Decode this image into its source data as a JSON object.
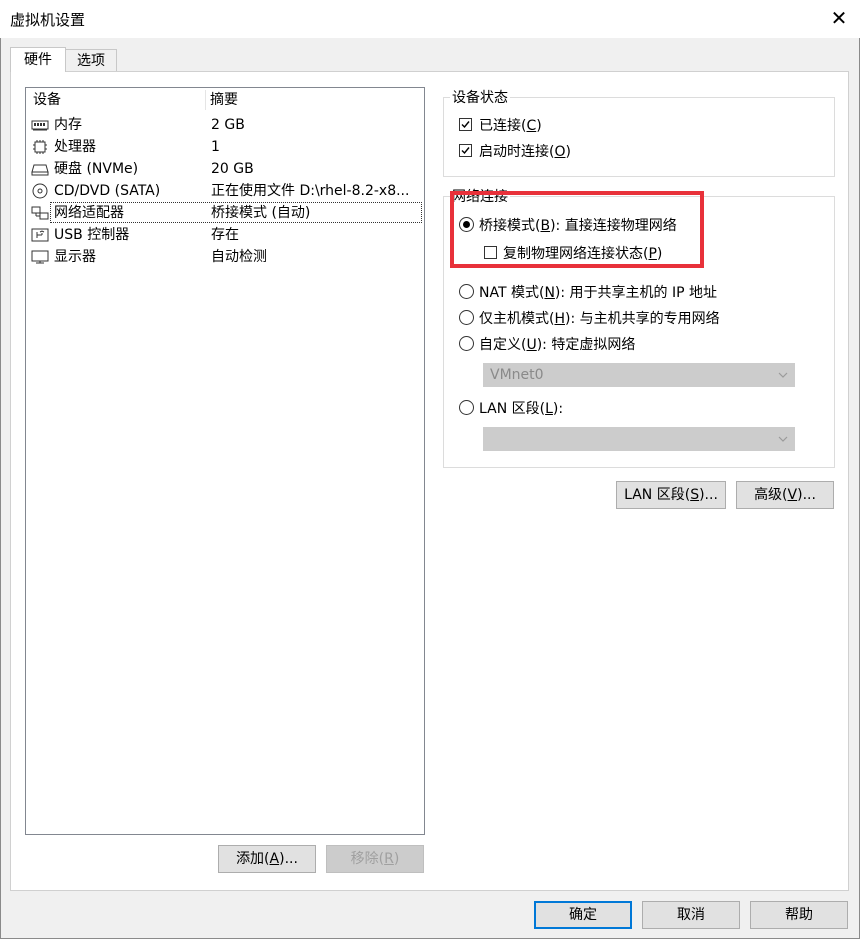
{
  "window": {
    "title": "虚拟机设置",
    "close_glyph": "✕"
  },
  "tabs": [
    {
      "label": "硬件",
      "active": true
    },
    {
      "label": "选项",
      "active": false
    }
  ],
  "device_list": {
    "headers": {
      "device": "设备",
      "summary": "摘要"
    },
    "rows": [
      {
        "name": "内存",
        "summary": "2 GB",
        "icon": "memory-icon"
      },
      {
        "name": "处理器",
        "summary": "1",
        "icon": "cpu-icon"
      },
      {
        "name": "硬盘 (NVMe)",
        "summary": "20 GB",
        "icon": "hard-disk-icon"
      },
      {
        "name": "CD/DVD (SATA)",
        "summary": "正在使用文件 D:\\rhel-8.2-x8...",
        "icon": "cd-dvd-icon"
      },
      {
        "name": "网络适配器",
        "summary": "桥接模式 (自动)",
        "icon": "network-adapter-icon",
        "selected": true
      },
      {
        "name": "USB 控制器",
        "summary": "存在",
        "icon": "usb-icon"
      },
      {
        "name": "显示器",
        "summary": "自动检测",
        "icon": "monitor-icon"
      }
    ]
  },
  "list_buttons": {
    "add": {
      "text": "添加(",
      "key": "A",
      "tail": ")..."
    },
    "remove": {
      "text": "移除(",
      "key": "R",
      "tail": ")"
    }
  },
  "device_status": {
    "title": "设备状态",
    "connected": {
      "text": "已连接(",
      "key": "C",
      "tail": ")",
      "checked": true
    },
    "connect_on_start": {
      "text": "启动时连接(",
      "key": "O",
      "tail": ")",
      "checked": true
    }
  },
  "network": {
    "title": "网络连接",
    "bridged": {
      "text": "桥接模式(",
      "key": "B",
      "tail": "): 直接连接物理网络",
      "selected": true
    },
    "replicate": {
      "text": "复制物理网络连接状态(",
      "key": "P",
      "tail": ")",
      "checked": false
    },
    "nat": {
      "text": "NAT 模式(",
      "key": "N",
      "tail": "): 用于共享主机的 IP 地址",
      "selected": false
    },
    "hostonly": {
      "text": "仅主机模式(",
      "key": "H",
      "tail": "): 与主机共享的专用网络",
      "selected": false
    },
    "custom": {
      "text": "自定义(",
      "key": "U",
      "tail": "): 特定虚拟网络",
      "selected": false
    },
    "custom_select_value": "VMnet0",
    "lan": {
      "text": "LAN 区段(",
      "key": "L",
      "tail": "):",
      "selected": false
    },
    "lan_select_value": ""
  },
  "network_buttons": {
    "lan_segments": {
      "text": "LAN 区段(",
      "key": "S",
      "tail": ")..."
    },
    "advanced": {
      "text": "高级(",
      "key": "V",
      "tail": ")..."
    }
  },
  "footer": {
    "ok": "确定",
    "cancel": "取消",
    "help": "帮助"
  },
  "colors": {
    "highlight": "#e8313a",
    "default_button_border": "#0078d7"
  }
}
